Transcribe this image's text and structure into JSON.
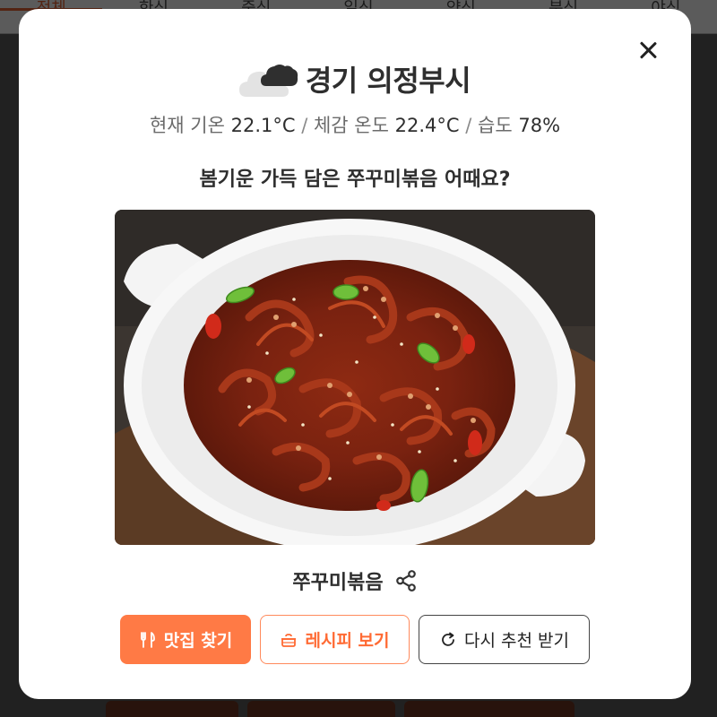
{
  "background": {
    "tabs": [
      "전체",
      "한식",
      "중식",
      "일식",
      "양식",
      "분식",
      "야식"
    ]
  },
  "modal": {
    "location": "경기 의정부시",
    "weather": {
      "current_label": "현재 기온",
      "current_value": "22.1°C",
      "feels_label": "체감 온도",
      "feels_value": "22.4°C",
      "humidity_label": "습도",
      "humidity_value": "78%",
      "icon": "cloud-icon"
    },
    "question": "봄기운 가득 담은 쭈꾸미볶음 어때요?",
    "food_name": "쭈꾸미볶음",
    "buttons": {
      "restaurants": "맛집 찾기",
      "recipe": "레시피 보기",
      "retry": "다시 추천 받기"
    },
    "colors": {
      "accent": "#ff7a45",
      "accent_border": "#ff8a5c"
    }
  }
}
